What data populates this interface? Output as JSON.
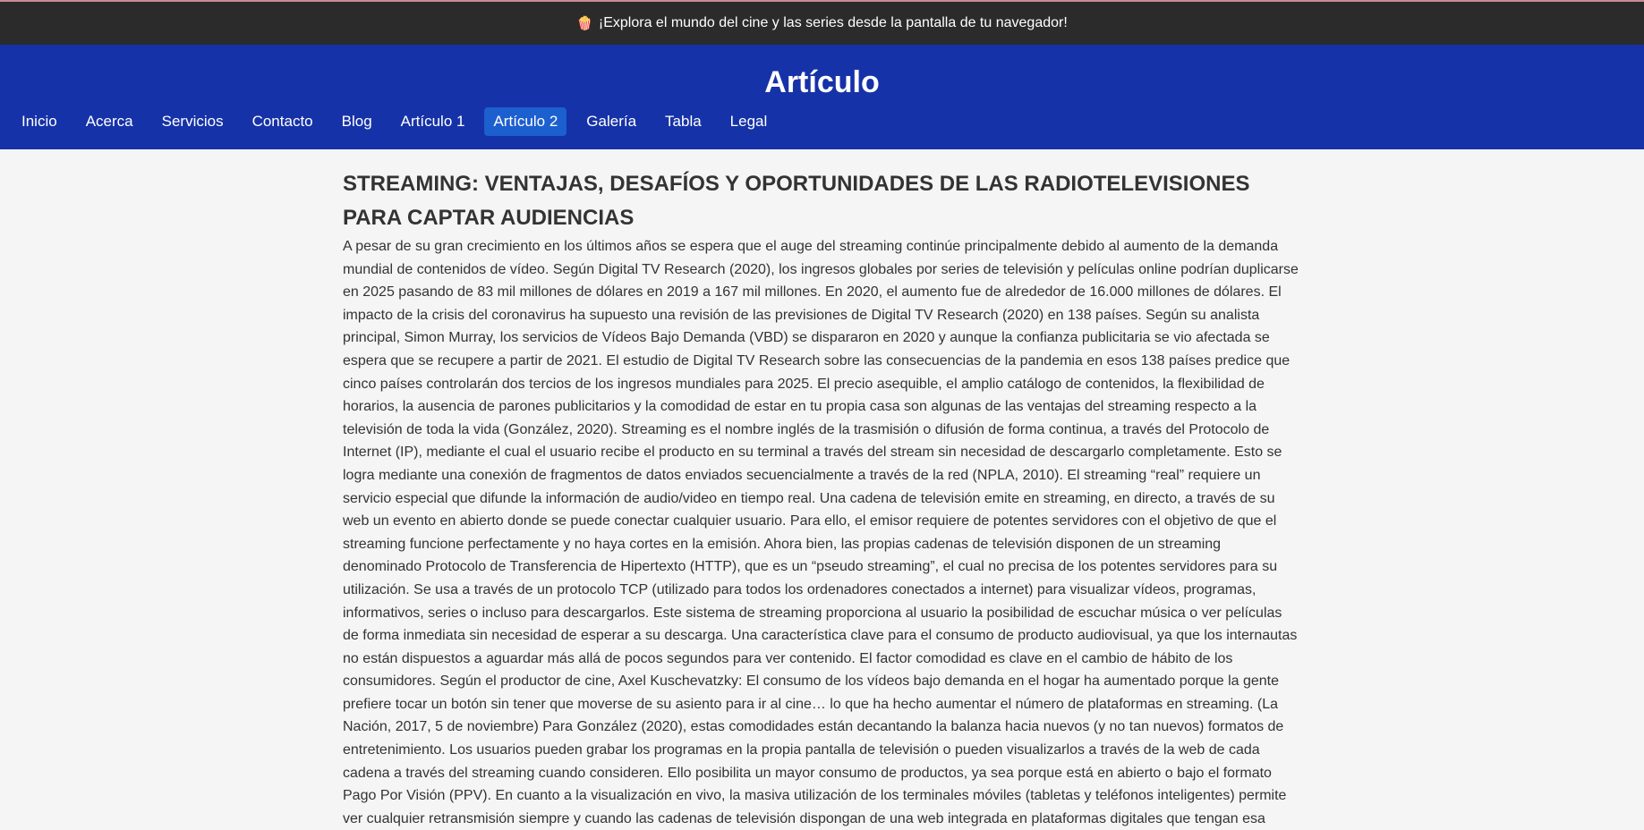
{
  "banner": {
    "icon": "popcorn-icon",
    "icon_glyph": "🍿",
    "text": "¡Explora el mundo del cine y las series desde la pantalla de tu navegador!"
  },
  "header": {
    "title": "Artículo"
  },
  "nav": {
    "items": [
      {
        "label": "Inicio",
        "active": false
      },
      {
        "label": "Acerca",
        "active": false
      },
      {
        "label": "Servicios",
        "active": false
      },
      {
        "label": "Contacto",
        "active": false
      },
      {
        "label": "Blog",
        "active": false
      },
      {
        "label": "Artículo 1",
        "active": false
      },
      {
        "label": "Artículo 2",
        "active": true
      },
      {
        "label": "Galería",
        "active": false
      },
      {
        "label": "Tabla",
        "active": false
      },
      {
        "label": "Legal",
        "active": false
      }
    ]
  },
  "article": {
    "heading": "STREAMING: VENTAJAS, DESAFÍOS Y OPORTUNIDADES DE LAS RADIOTELEVISIONES PARA CAPTAR AUDIENCIAS",
    "body": "A pesar de su gran crecimiento en los últimos años se espera que el auge del streaming continúe principalmente debido al aumento de la demanda mundial de contenidos de vídeo. Según Digital TV Research (2020), los ingresos globales por series de televisión y películas online podrían duplicarse en 2025 pasando de 83 mil millones de dólares en 2019 a 167 mil millones. En 2020, el aumento fue de alrededor de 16.000 millones de dólares. El impacto de la crisis del coronavirus ha supuesto una revisión de las previsiones de Digital TV Research (2020) en 138 países. Según su analista principal, Simon Murray, los servicios de Vídeos Bajo Demanda (VBD) se dispararon en 2020 y aunque la confianza publicitaria se vio afectada se espera que se recupere a partir de 2021. El estudio de Digital TV Research sobre las consecuencias de la pandemia en esos 138 países predice que cinco países controlarán dos tercios de los ingresos mundiales para 2025. El precio asequible, el amplio catálogo de contenidos, la flexibilidad de horarios, la ausencia de parones publicitarios y la comodidad de estar en tu propia casa son algunas de las ventajas del streaming respecto a la televisión de toda la vida (González, 2020). Streaming es el nombre inglés de la trasmisión o difusión de forma continua, a través del Protocolo de Internet (IP), mediante el cual el usuario recibe el producto en su terminal a través del stream sin necesidad de descargarlo completamente. Esto se logra mediante una conexión de fragmentos de datos enviados secuencialmente a través de la red (NPLA, 2010). El streaming “real” requiere un servicio especial que difunde la información de audio/video en tiempo real. Una cadena de televisión emite en streaming, en directo, a través de su web un evento en abierto donde se puede conectar cualquier usuario. Para ello, el emisor requiere de potentes servidores con el objetivo de que el streaming funcione perfectamente y no haya cortes en la emisión. Ahora bien, las propias cadenas de televisión disponen de un streaming denominado Protocolo de Transferencia de Hipertexto (HTTP), que es un “pseudo streaming”, el cual no precisa de los potentes servidores para su utilización. Se usa a través de un protocolo TCP (utilizado para todos los ordenadores conectados a internet) para visualizar vídeos, programas, informativos, series o incluso para descargarlos. Este sistema de streaming proporciona al usuario la posibilidad de escuchar música o ver películas de forma inmediata sin necesidad de esperar a su descarga. Una característica clave para el consumo de producto audiovisual, ya que los internautas no están dispuestos a aguardar más allá de pocos segundos para ver contenido. El factor comodidad es clave en el cambio de hábito de los consumidores. Según el productor de cine, Axel Kuschevatzky: El consumo de los vídeos bajo demanda en el hogar ha aumentado porque la gente prefiere tocar un botón sin tener que moverse de su asiento para ir al cine… lo que ha hecho aumentar el número de plataformas en streaming. (La Nación, 2017, 5 de noviembre) Para González (2020), estas comodidades están decantando la balanza hacia nuevos (y no tan nuevos) formatos de entretenimiento. Los usuarios pueden grabar los programas en la propia pantalla de televisión o pueden visualizarlos a través de la web de cada cadena a través del streaming cuando consideren. Ello posibilita un mayor consumo de productos, ya sea porque está en abierto o bajo el formato Pago Por Visión (PPV). En cuanto a la visualización en vivo, la masiva utilización de los terminales móviles (tabletas y teléfonos inteligentes) permite ver cualquier retransmisión siempre y cuando las cadenas de televisión dispongan de una web integrada en plataformas digitales que tengan esa"
  }
}
